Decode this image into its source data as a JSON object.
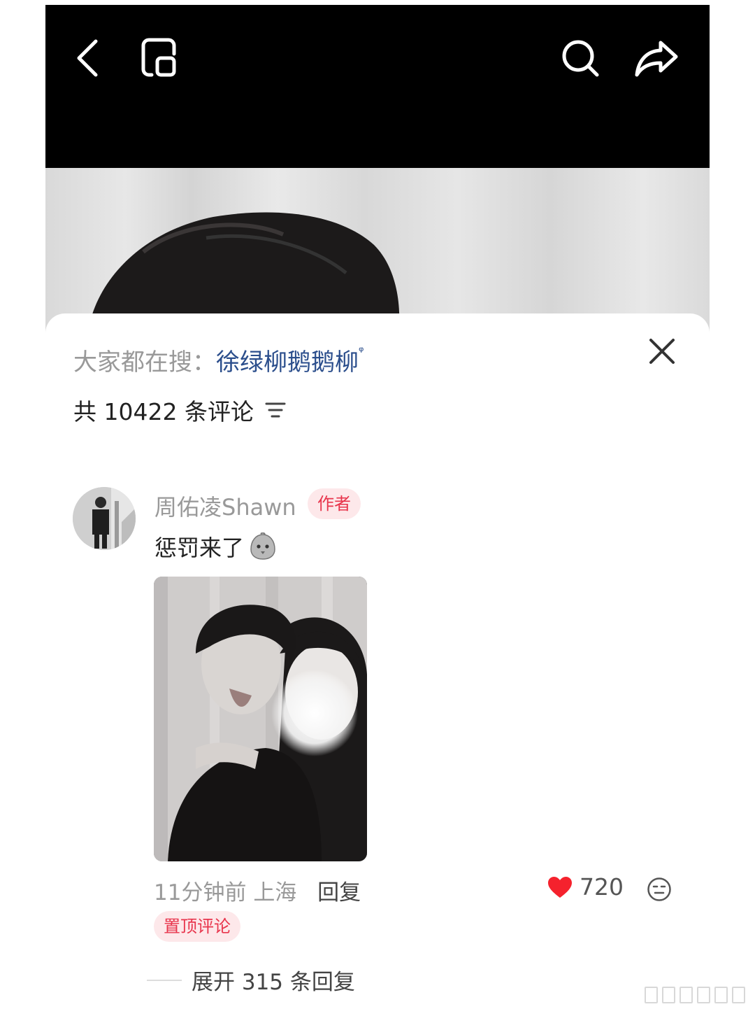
{
  "topbar": {
    "icons": [
      "back-icon",
      "mini-window-icon",
      "search-icon",
      "share-icon"
    ]
  },
  "sheet": {
    "search_prefix": "大家都在搜：",
    "search_term": "徐绿柳鹅鹅柳",
    "search_mark": "ᵠ",
    "count_text": "共 10422 条评论"
  },
  "comment": {
    "username": "周佑凌Shawn",
    "author_badge": "作者",
    "text": "惩罚来了",
    "time": "11分钟前",
    "location": "上海",
    "reply_label": "回复",
    "likes": "720",
    "like_color": "#f5222d",
    "pinned_label": "置顶评论",
    "expand_label": "展开 315 条回复"
  }
}
